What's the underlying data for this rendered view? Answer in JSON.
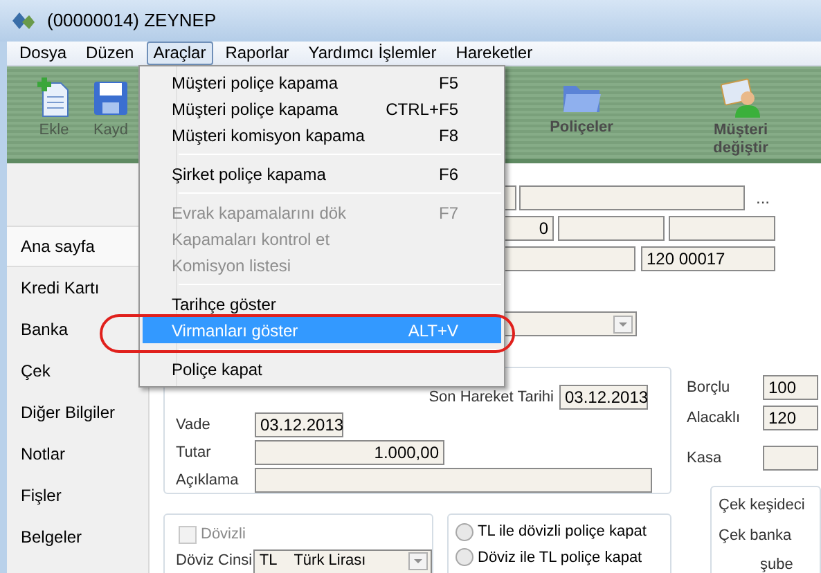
{
  "window": {
    "title": "(00000014)  ZEYNEP"
  },
  "menu_bar": [
    {
      "label": "Dosya",
      "selected": false
    },
    {
      "label": "Düzen",
      "selected": false
    },
    {
      "label": "Araçlar",
      "selected": true
    },
    {
      "label": "Raporlar",
      "selected": false
    },
    {
      "label": "Yardımcı İşlemler",
      "selected": false
    },
    {
      "label": "Hareketler",
      "selected": false
    }
  ],
  "toolbar": [
    {
      "kind": "add",
      "label": "Ekle",
      "disabled": true
    },
    {
      "kind": "save",
      "label": "Kayd",
      "disabled": true
    },
    {
      "kind": "folder",
      "label": "Poliçeler",
      "disabled": false
    },
    {
      "kind": "customer",
      "label": "Müşteri değiştir",
      "disabled": false
    }
  ],
  "dropdown_menu": [
    {
      "kind": "item",
      "label": "Müşteri poliçe kapama",
      "shortcut": "F5",
      "disabled": false,
      "selected": false
    },
    {
      "kind": "item",
      "label": "Müşteri poliçe kapama",
      "shortcut": "CTRL+F5",
      "disabled": false,
      "selected": false
    },
    {
      "kind": "item",
      "label": "Müşteri komisyon kapama",
      "shortcut": "F8",
      "disabled": false,
      "selected": false
    },
    {
      "kind": "separator"
    },
    {
      "kind": "item",
      "label": "Şirket poliçe kapama",
      "shortcut": "F6",
      "disabled": false,
      "selected": false
    },
    {
      "kind": "separator"
    },
    {
      "kind": "item",
      "label": "Evrak kapamalarını dök",
      "shortcut": "F7",
      "disabled": true,
      "selected": false
    },
    {
      "kind": "item",
      "label": "Kapamaları kontrol et",
      "disabled": true,
      "selected": false
    },
    {
      "kind": "item",
      "label": "Komisyon listesi",
      "disabled": true,
      "selected": false
    },
    {
      "kind": "separator"
    },
    {
      "kind": "item",
      "label": "Tarihçe göster",
      "disabled": false,
      "selected": false
    },
    {
      "kind": "item",
      "label": "Virmanları göster",
      "shortcut": "ALT+V",
      "disabled": false,
      "selected": true
    },
    {
      "kind": "separator"
    },
    {
      "kind": "item",
      "label": "Poliçe kapat",
      "disabled": false,
      "selected": false
    }
  ],
  "sidebar": {
    "items": [
      {
        "label": "Ana sayfa",
        "selected": true
      },
      {
        "label": "Kredi Kartı",
        "selected": false
      },
      {
        "label": "Banka",
        "selected": false
      },
      {
        "label": "Çek",
        "selected": false
      },
      {
        "label": "Diğer Bilgiler",
        "selected": false
      },
      {
        "label": "Notlar",
        "selected": false
      },
      {
        "label": "Fişler",
        "selected": false
      },
      {
        "label": "Belgeler",
        "selected": false
      }
    ]
  },
  "header": {
    "more_button": "...",
    "counter": "0",
    "account_code": "120 00017"
  },
  "form": {
    "son_hareket_tarihi": {
      "label": "Son Hareket Tarihi",
      "value": "03.12.2013"
    },
    "vade": {
      "label": "Vade",
      "value": "03.12.2013"
    },
    "tutar": {
      "label": "Tutar",
      "value": "1.000,00"
    },
    "aciklama": {
      "label": "Açıklama"
    }
  },
  "accounts": {
    "borclu": {
      "label": "Borçlu",
      "value": "100"
    },
    "alacakli": {
      "label": "Alacaklı",
      "value": "120"
    },
    "kasa": {
      "label": "Kasa"
    }
  },
  "cheque": {
    "labels": [
      "Çek keşideci",
      "Çek banka",
      "şube"
    ]
  },
  "currency": {
    "dovizli": {
      "label": "Dövizli",
      "checked": false,
      "disabled": true
    },
    "doviz_cinsi": {
      "label": "Döviz Cinsi",
      "code": "TL",
      "name": "Türk Lirası"
    }
  },
  "options": [
    {
      "label": "TL ile dövizli poliçe kapat",
      "selected": false
    },
    {
      "label": "Döviz ile TL poliçe kapat",
      "selected": false
    }
  ]
}
